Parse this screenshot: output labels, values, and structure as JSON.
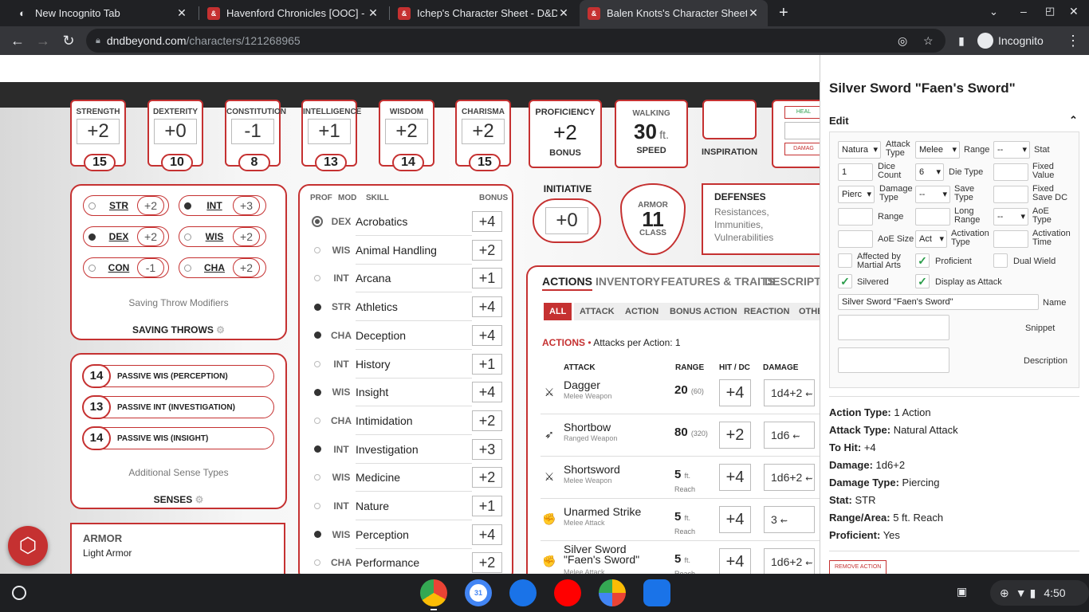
{
  "tabs": [
    {
      "title": "New Incognito Tab",
      "icon": "incognito-icon",
      "active": false
    },
    {
      "title": "Havenford Chronicles [OOC] - Pla",
      "icon": "dndbeyond-icon",
      "active": false
    },
    {
      "title": "Ichep's Character Sheet - D&D Be",
      "icon": "dndbeyond-icon",
      "active": false
    },
    {
      "title": "Balen Knots's Character Sheet - D",
      "icon": "dndbeyond-icon",
      "active": true
    }
  ],
  "address": {
    "host": "dndbeyond.com",
    "path": "/characters/121268965",
    "incognito_label": "Incognito"
  },
  "abilities": [
    {
      "name": "STRENGTH",
      "mod": "+2",
      "score": "15"
    },
    {
      "name": "DEXTERITY",
      "mod": "+0",
      "score": "10"
    },
    {
      "name": "CONSTITUTION",
      "mod": "-1",
      "score": "8"
    },
    {
      "name": "INTELLIGENCE",
      "mod": "+1",
      "score": "13"
    },
    {
      "name": "WISDOM",
      "mod": "+2",
      "score": "14"
    },
    {
      "name": "CHARISMA",
      "mod": "+2",
      "score": "15"
    }
  ],
  "proficiency": {
    "label": "PROFICIENCY",
    "value": "+2",
    "sub": "BONUS"
  },
  "walking": {
    "label": "WALKING",
    "value": "30",
    "unit": "ft.",
    "sub": "SPEED"
  },
  "inspiration": {
    "label": "INSPIRATION"
  },
  "heal": {
    "heal": "HEAL",
    "damage": "DAMAG"
  },
  "initiative": {
    "label": "INITIATIVE",
    "value": "+0"
  },
  "armor": {
    "top": "ARMOR",
    "value": "11",
    "sub": "CLASS"
  },
  "defenses": {
    "title": "DEFENSES",
    "text": "Resistances, Immunities, Vulnerabilities"
  },
  "saves": {
    "items": [
      {
        "name": "STR",
        "mod": "+2",
        "prof": false
      },
      {
        "name": "INT",
        "mod": "+3",
        "prof": true
      },
      {
        "name": "DEX",
        "mod": "+2",
        "prof": true
      },
      {
        "name": "WIS",
        "mod": "+2",
        "prof": false
      },
      {
        "name": "CON",
        "mod": "-1",
        "prof": false
      },
      {
        "name": "CHA",
        "mod": "+2",
        "prof": false
      }
    ],
    "caption": "Saving Throw Modifiers",
    "title": "SAVING THROWS"
  },
  "senses": {
    "items": [
      {
        "value": "14",
        "label": "PASSIVE WIS (PERCEPTION)"
      },
      {
        "value": "13",
        "label": "PASSIVE INT (INVESTIGATION)"
      },
      {
        "value": "14",
        "label": "PASSIVE WIS (INSIGHT)"
      }
    ],
    "caption": "Additional Sense Types",
    "title": "SENSES"
  },
  "armor_prof": {
    "title": "ARMOR",
    "value": "Light Armor"
  },
  "skills": {
    "headers": {
      "prof": "PROF",
      "mod": "MOD",
      "skill": "SKILL",
      "bonus": "BONUS"
    },
    "items": [
      {
        "mod": "DEX",
        "name": "Acrobatics",
        "bonus": "+4",
        "prof": "expert"
      },
      {
        "mod": "WIS",
        "name": "Animal Handling",
        "bonus": "+2",
        "prof": "none"
      },
      {
        "mod": "INT",
        "name": "Arcana",
        "bonus": "+1",
        "prof": "none"
      },
      {
        "mod": "STR",
        "name": "Athletics",
        "bonus": "+4",
        "prof": "prof"
      },
      {
        "mod": "CHA",
        "name": "Deception",
        "bonus": "+4",
        "prof": "prof"
      },
      {
        "mod": "INT",
        "name": "History",
        "bonus": "+1",
        "prof": "none"
      },
      {
        "mod": "WIS",
        "name": "Insight",
        "bonus": "+4",
        "prof": "prof"
      },
      {
        "mod": "CHA",
        "name": "Intimidation",
        "bonus": "+2",
        "prof": "none"
      },
      {
        "mod": "INT",
        "name": "Investigation",
        "bonus": "+3",
        "prof": "prof"
      },
      {
        "mod": "WIS",
        "name": "Medicine",
        "bonus": "+2",
        "prof": "none"
      },
      {
        "mod": "INT",
        "name": "Nature",
        "bonus": "+1",
        "prof": "none"
      },
      {
        "mod": "WIS",
        "name": "Perception",
        "bonus": "+4",
        "prof": "prof"
      },
      {
        "mod": "CHA",
        "name": "Performance",
        "bonus": "+2",
        "prof": "none"
      }
    ]
  },
  "actions_tabs": [
    "ACTIONS",
    "INVENTORY",
    "FEATURES & TRAITS",
    "DESCRIPTIO"
  ],
  "filters": [
    "ALL",
    "ATTACK",
    "ACTION",
    "BONUS ACTION",
    "REACTION",
    "OTHE"
  ],
  "actions_heading": {
    "label": "ACTIONS",
    "sub": "Attacks per Action: 1"
  },
  "attack_headers": {
    "attack": "ATTACK",
    "range": "RANGE",
    "hit": "HIT / DC",
    "damage": "DAMAGE"
  },
  "attacks": [
    {
      "name": "Dagger",
      "type": "Melee Weapon",
      "range": "20",
      "range_sub": "(60)",
      "hit": "+4",
      "damage": "1d4+2",
      "icon": "crossed-swords-icon"
    },
    {
      "name": "Shortbow",
      "type": "Ranged Weapon",
      "range": "80",
      "range_sub": "(320)",
      "hit": "+2",
      "damage": "1d6",
      "icon": "bow-icon"
    },
    {
      "name": "Shortsword",
      "type": "Melee Weapon",
      "range": "5",
      "range_unit": "ft.",
      "range_sub": "Reach",
      "hit": "+4",
      "damage": "1d6+2",
      "icon": "crossed-swords-icon"
    },
    {
      "name": "Unarmed Strike",
      "type": "Melee Attack",
      "range": "5",
      "range_unit": "ft.",
      "range_sub": "Reach",
      "hit": "+4",
      "damage": "3",
      "icon": "fist-icon"
    },
    {
      "name": "Silver Sword \"Faen's Sword\"",
      "type": "Melee Attack",
      "range": "5",
      "range_unit": "ft.",
      "range_sub": "Reach",
      "hit": "+4",
      "damage": "1d6+2",
      "icon": "fist-icon"
    }
  ],
  "panel": {
    "title": "Silver Sword \"Faen's Sword\"",
    "edit": "Edit",
    "fields": {
      "attack_type_value": "Natura",
      "attack_type_label": "Attack Type",
      "range_value": "Melee",
      "range_label": "Range",
      "stat_value": "--",
      "stat_label": "Stat",
      "dice_count_value": "1",
      "dice_count_label": "Dice Count",
      "die_type_value": "6",
      "die_type_label": "Die Type",
      "fixed_value_label": "Fixed Value",
      "damage_type_value": "Pierc",
      "damage_type_label": "Damage Type",
      "save_type_value": "--",
      "save_type_label": "Save Type",
      "fixed_dc_label": "Fixed Save DC",
      "range2_label": "Range",
      "long_range_label": "Long Range",
      "aoe_type_value": "--",
      "aoe_type_label": "AoE Type",
      "aoe_size_label": "AoE Size",
      "activation_value": "Act",
      "activation_label": "Activation Type",
      "activation_time_label": "Activation Time",
      "martial_label": "Affected by Martial Arts",
      "proficient_label": "Proficient",
      "dual_label": "Dual Wield",
      "silvered_label": "Silvered",
      "display_label": "Display as Attack",
      "name_value": "Silver Sword \"Faen's Sword\"",
      "name_label": "Name",
      "snippet_label": "Snippet",
      "description_label": "Description"
    },
    "props": [
      {
        "k": "Action Type:",
        "v": "1 Action"
      },
      {
        "k": "Attack Type:",
        "v": "Natural Attack"
      },
      {
        "k": "To Hit:",
        "v": "+4"
      },
      {
        "k": "Damage:",
        "v": "1d6+2"
      },
      {
        "k": "Damage Type:",
        "v": "Piercing"
      },
      {
        "k": "Stat:",
        "v": "STR"
      },
      {
        "k": "Range/Area:",
        "v": "5 ft. Reach"
      },
      {
        "k": "Proficient:",
        "v": "Yes"
      }
    ],
    "remove": "REMOVE ACTION"
  },
  "shelf": {
    "time": "4:50"
  },
  "colors": {
    "accent": "#c53131",
    "chrome": "#202124"
  }
}
